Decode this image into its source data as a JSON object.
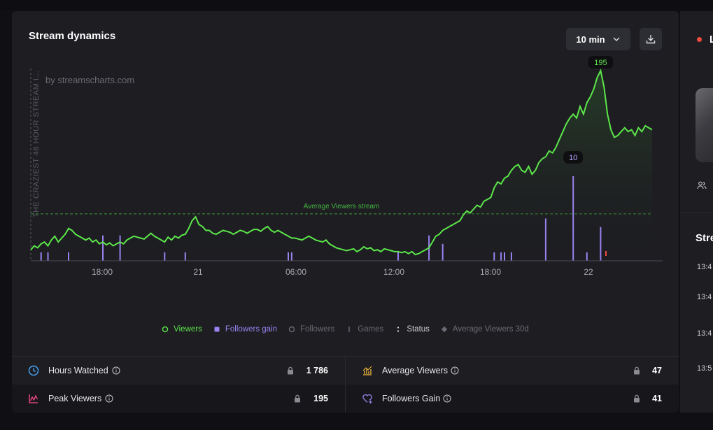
{
  "card": {
    "title": "Stream dynamics",
    "interval_label": "10 min",
    "watermark": "by streamscharts.com",
    "stream_label": "THE CRAZIEST 48 HOUR STREAM I..."
  },
  "chart_data": {
    "type": "line",
    "title": "",
    "x_ticks": [
      "18:00",
      "21",
      "06:00",
      "12:00",
      "18:00",
      "22"
    ],
    "reference_line": {
      "label": "Average Viewers stream",
      "value": 47
    },
    "annotations": [
      {
        "series": "Viewers",
        "label": "195",
        "value": 195
      },
      {
        "series": "Followers gain",
        "label": "10",
        "value": 10
      }
    ],
    "series": [
      {
        "name": "Viewers",
        "color": "#5ce64a",
        "values": [
          10,
          14,
          12,
          16,
          18,
          14,
          20,
          24,
          18,
          22,
          26,
          32,
          30,
          26,
          24,
          22,
          20,
          22,
          18,
          20,
          16,
          18,
          15,
          17,
          14,
          16,
          18,
          16,
          20,
          22,
          24,
          23,
          22,
          21,
          24,
          27,
          24,
          22,
          20,
          18,
          23,
          20,
          24,
          22,
          25,
          26,
          32,
          40,
          44,
          36,
          34,
          30,
          30,
          27,
          26,
          28,
          30,
          29,
          28,
          26,
          28,
          30,
          29,
          27,
          29,
          31,
          31,
          29,
          32,
          34,
          30,
          28,
          30,
          28,
          26,
          24,
          22,
          22,
          21,
          20,
          22,
          24,
          22,
          20,
          19,
          18,
          20,
          16,
          14,
          12,
          11,
          10,
          9,
          10,
          11,
          8,
          10,
          13,
          11,
          12,
          9,
          10,
          8,
          11,
          10,
          9,
          8,
          8,
          7,
          8,
          6,
          8,
          5,
          6,
          8,
          10,
          12,
          18,
          24,
          26,
          30,
          32,
          34,
          36,
          38,
          40,
          46,
          50,
          48,
          52,
          56,
          54,
          60,
          62,
          64,
          74,
          80,
          78,
          84,
          86,
          92,
          96,
          98,
          92,
          90,
          96,
          88,
          92,
          100,
          104,
          106,
          112,
          110,
          116,
          124,
          132,
          140,
          146,
          150,
          146,
          158,
          150,
          162,
          168,
          176,
          188,
          195,
          178,
          150,
          134,
          126,
          128,
          132,
          136,
          132,
          134,
          128,
          136,
          132,
          138,
          136,
          134
        ]
      },
      {
        "name": "Followers gain",
        "color": "#9a82f0",
        "bars": [
          {
            "i": 3,
            "v": 1
          },
          {
            "i": 5,
            "v": 1
          },
          {
            "i": 11,
            "v": 1
          },
          {
            "i": 21,
            "v": 3
          },
          {
            "i": 26,
            "v": 3
          },
          {
            "i": 39,
            "v": 1
          },
          {
            "i": 45,
            "v": 1
          },
          {
            "i": 75,
            "v": 1
          },
          {
            "i": 76,
            "v": 1
          },
          {
            "i": 107,
            "v": 1
          },
          {
            "i": 116,
            "v": 3
          },
          {
            "i": 120,
            "v": 2
          },
          {
            "i": 135,
            "v": 1
          },
          {
            "i": 137,
            "v": 1
          },
          {
            "i": 138,
            "v": 1
          },
          {
            "i": 140,
            "v": 1
          },
          {
            "i": 150,
            "v": 5
          },
          {
            "i": 158,
            "v": 10
          },
          {
            "i": 162,
            "v": 1
          },
          {
            "i": 166,
            "v": 4
          }
        ]
      }
    ],
    "legend": [
      {
        "name": "Viewers",
        "active": true,
        "color": "#5ce64a",
        "marker": "circle"
      },
      {
        "name": "Followers gain",
        "active": true,
        "color": "#9a82f0",
        "marker": "square"
      },
      {
        "name": "Followers",
        "active": false,
        "color": "#6a6a72",
        "marker": "circle"
      },
      {
        "name": "Games",
        "active": false,
        "color": "#6a6a72",
        "marker": "bar"
      },
      {
        "name": "Status",
        "active": true,
        "color": "#e0e0e4",
        "marker": "dots"
      },
      {
        "name": "Average Viewers 30d",
        "active": false,
        "color": "#6a7a8a",
        "marker": "diamond"
      }
    ]
  },
  "stats": [
    {
      "label": "Hours Watched",
      "value": "1 786",
      "icon": "clock-icon",
      "color": "#4aa8ff"
    },
    {
      "label": "Average Viewers",
      "value": "47",
      "icon": "bar-chart-icon",
      "color": "#f0b43c"
    },
    {
      "label": "Peak Viewers",
      "value": "195",
      "icon": "peak-chart-icon",
      "color": "#ff4b8a"
    },
    {
      "label": "Followers Gain",
      "value": "41",
      "icon": "heart-plus-icon",
      "color": "#9a82f0"
    }
  ],
  "right_panel": {
    "title_initial": "L",
    "heading": "Stre",
    "times": [
      "13:4",
      "13:4",
      "13:4",
      "13:5"
    ]
  }
}
